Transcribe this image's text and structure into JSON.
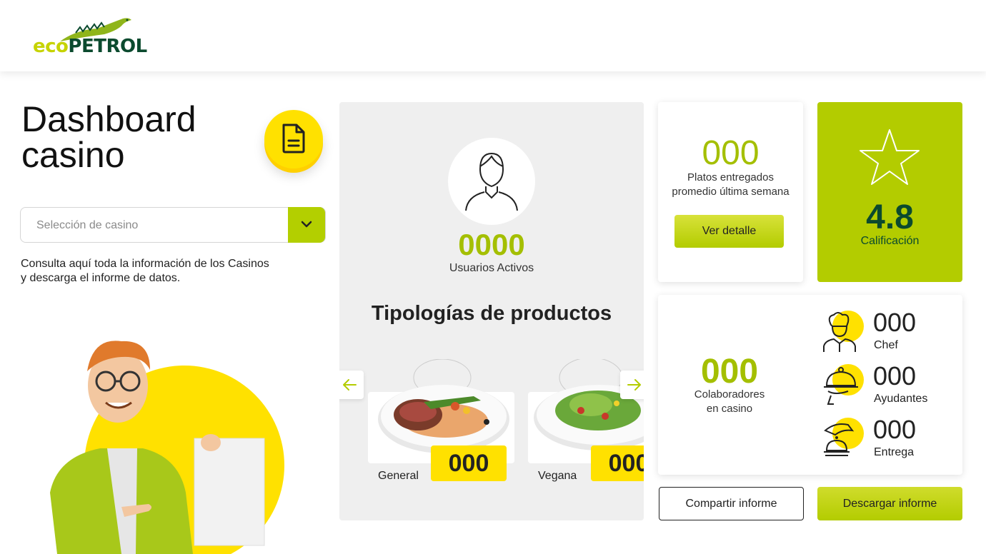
{
  "header": {
    "logo": {
      "part1": "eco",
      "part2": "PETROL"
    }
  },
  "page": {
    "title_line1": "Dashboard",
    "title_line2": "casino",
    "select": {
      "placeholder": "Selección de casino"
    },
    "description_line1": "Consulta aquí toda la información de los Casinos",
    "description_line2": "y descarga el informe de datos."
  },
  "usuarios": {
    "count": "0000",
    "label": "Usuarios Activos"
  },
  "tipologias": {
    "title": "Tipologías de productos",
    "items": [
      {
        "label": "General",
        "count": "000"
      },
      {
        "label": "Vegana",
        "count": "000"
      }
    ]
  },
  "platos": {
    "count": "000",
    "label_line1": "Platos entregados",
    "label_line2": "promedio última semana",
    "button": "Ver detalle"
  },
  "calificacion": {
    "value": "4.8",
    "label": "Calificación"
  },
  "colaboradores": {
    "count": "000",
    "label_line1": "Colaboradores",
    "label_line2": "en casino",
    "roles": [
      {
        "count": "000",
        "label": "Chef",
        "icon": "chef-icon"
      },
      {
        "count": "000",
        "label": "Ayudantes",
        "icon": "cloche-icon"
      },
      {
        "count": "000",
        "label": "Entrega",
        "icon": "delivery-icon"
      }
    ]
  },
  "actions": {
    "share": "Compartir informe",
    "download": "Descargar informe"
  },
  "colors": {
    "accent_green": "#b3cc00",
    "accent_yellow": "#ffe100",
    "dark_green": "#0b4a2e"
  }
}
